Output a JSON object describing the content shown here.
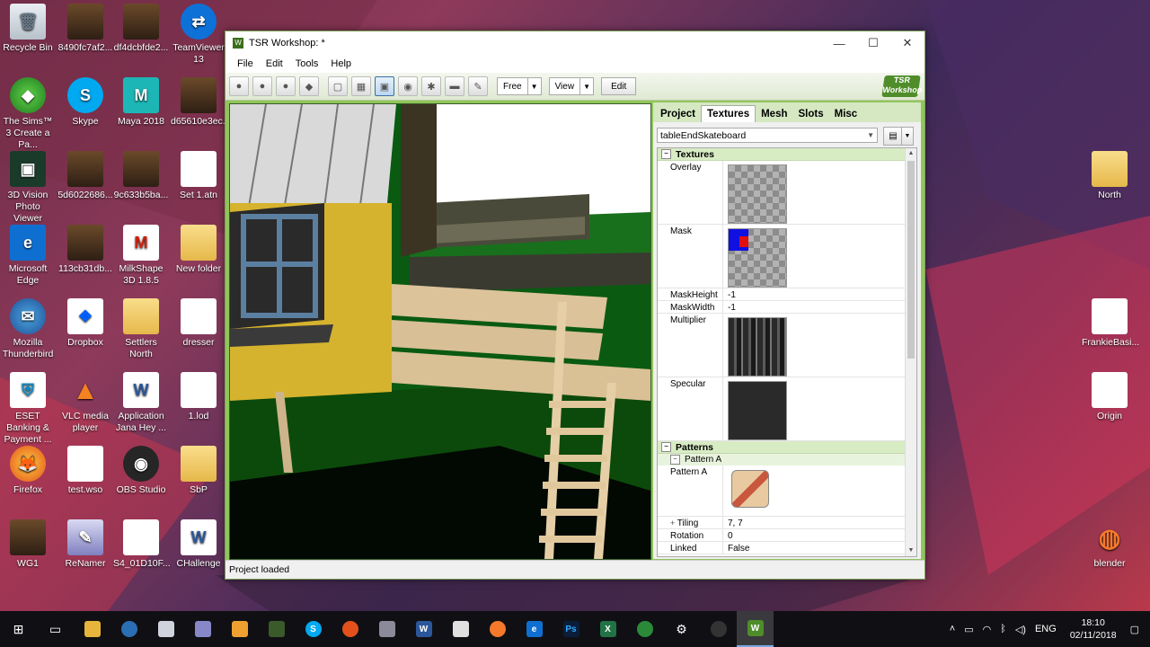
{
  "desktop": {
    "icons": [
      {
        "label": "Recycle Bin",
        "glyph": "🗑"
      },
      {
        "label": "8490fc7af2...",
        "glyph": ""
      },
      {
        "label": "df4dcbfde2...",
        "glyph": ""
      },
      {
        "label": "TeamViewer 13",
        "glyph": "⇄"
      },
      {
        "label": "The Sims™ 3 Create a Pa...",
        "glyph": "◆"
      },
      {
        "label": "Skype",
        "glyph": "S"
      },
      {
        "label": "Maya 2018",
        "glyph": "M"
      },
      {
        "label": "d65610e3ec...",
        "glyph": ""
      },
      {
        "label": "3D Vision Photo Viewer",
        "glyph": "▣"
      },
      {
        "label": "5d6022686...",
        "glyph": ""
      },
      {
        "label": "9c633b5ba...",
        "glyph": ""
      },
      {
        "label": "Set 1.atn",
        "glyph": ""
      },
      {
        "label": "Microsoft Edge",
        "glyph": "e"
      },
      {
        "label": "113cb31db...",
        "glyph": ""
      },
      {
        "label": "MilkShape 3D 1.8.5",
        "glyph": "M"
      },
      {
        "label": "New folder",
        "glyph": ""
      },
      {
        "label": "Mozilla Thunderbird",
        "glyph": "✉"
      },
      {
        "label": "Dropbox",
        "glyph": "❖"
      },
      {
        "label": "Settlers North",
        "glyph": ""
      },
      {
        "label": "dresser",
        "glyph": ""
      },
      {
        "label": "ESET Banking & Payment ...",
        "glyph": "⛨"
      },
      {
        "label": "VLC media player",
        "glyph": "▲"
      },
      {
        "label": "Application Jana Hey ...",
        "glyph": "W"
      },
      {
        "label": "1.lod",
        "glyph": ""
      },
      {
        "label": "Firefox",
        "glyph": "🦊"
      },
      {
        "label": "test.wso",
        "glyph": ""
      },
      {
        "label": "OBS Studio",
        "glyph": "◉"
      },
      {
        "label": "SbP",
        "glyph": ""
      },
      {
        "label": "WG1",
        "glyph": ""
      },
      {
        "label": "ReNamer",
        "glyph": "✎"
      },
      {
        "label": "S4_01D10F...",
        "glyph": ""
      },
      {
        "label": "CHallenge",
        "glyph": "W"
      },
      {
        "label": "North",
        "glyph": ""
      },
      {
        "label": "FrankieBasi...",
        "glyph": ""
      },
      {
        "label": "Origin",
        "glyph": ""
      },
      {
        "label": "blender",
        "glyph": "◍"
      }
    ]
  },
  "window": {
    "title": "TSR Workshop: *",
    "controls": {
      "minimize": "—",
      "maximize": "☐",
      "close": "✕"
    },
    "menu": [
      "File",
      "Edit",
      "Tools",
      "Help"
    ],
    "toolbar": {
      "camera_mode": "Free",
      "view_label": "View",
      "edit_label": "Edit",
      "logo_text": "TSR Workshop"
    },
    "panel": {
      "tabs": [
        "Project",
        "Textures",
        "Mesh",
        "Slots",
        "Misc"
      ],
      "active_tab": "Textures",
      "texture_set": "tableEndSkateboard",
      "sections": {
        "textures": "Textures",
        "patterns": "Patterns",
        "pattern_a_group": "Pattern A"
      },
      "props": {
        "overlay": "Overlay",
        "mask": "Mask",
        "mask_height_k": "MaskHeight",
        "mask_height_v": "-1",
        "mask_width_k": "MaskWidth",
        "mask_width_v": "-1",
        "multiplier": "Multiplier",
        "specular": "Specular",
        "pattern_a": "Pattern A",
        "tiling_k": "Tiling",
        "tiling_v": "7, 7",
        "rotation_k": "Rotation",
        "rotation_v": "0",
        "linked_k": "Linked",
        "linked_v": "False"
      }
    },
    "status": "Project loaded"
  },
  "taskbar": {
    "tray": {
      "lang": "ENG",
      "time": "18:10",
      "date": "02/11/2018"
    }
  }
}
